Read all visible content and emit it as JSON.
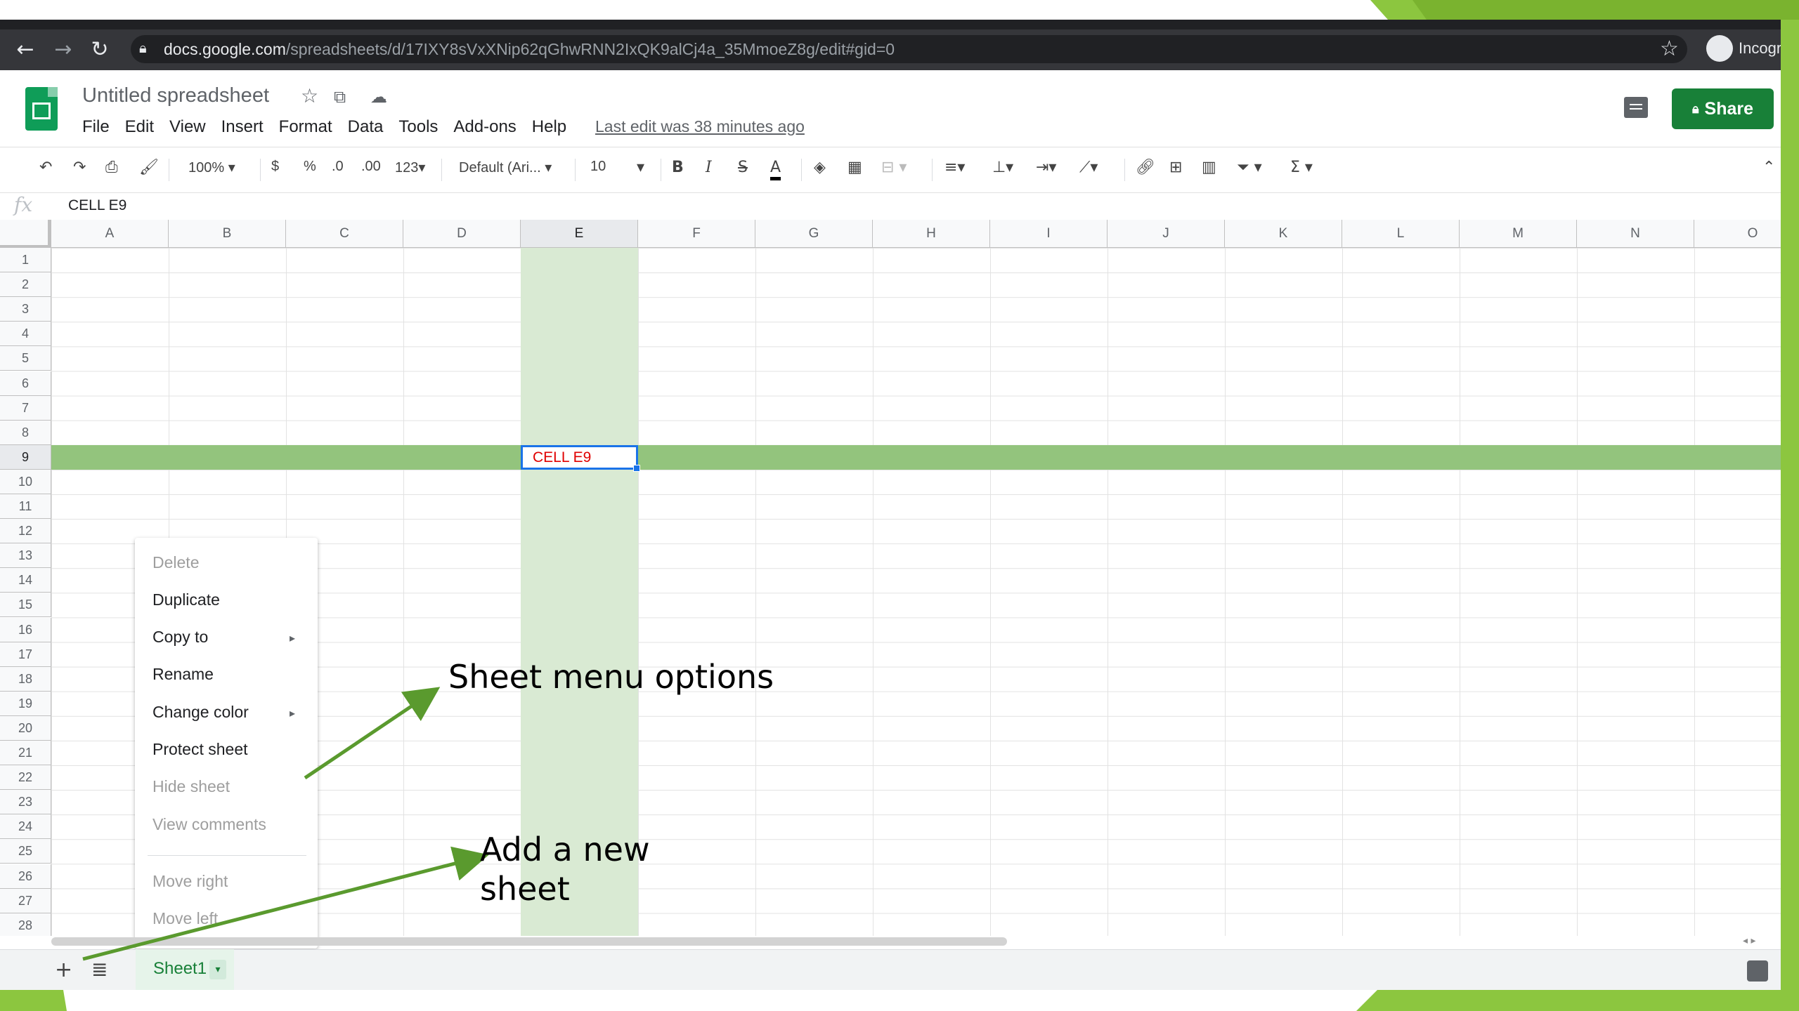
{
  "browser": {
    "url_host": "docs.google.com",
    "url_path": "/spreadsheets/d/17IXY8sVxXNip62qGhwRNN2IxQK9alCj4a_35MmoeZ8g/edit#gid=0",
    "profile_label": "Incogr"
  },
  "app": {
    "title": "Untitled spreadsheet",
    "menu": [
      "File",
      "Edit",
      "View",
      "Insert",
      "Format",
      "Data",
      "Tools",
      "Add-ons",
      "Help"
    ],
    "last_edit": "Last edit was 38 minutes ago",
    "share_label": "Share"
  },
  "toolbar": {
    "zoom": "100%",
    "currency": "$",
    "percent": "%",
    "dec_decrease": ".0",
    "dec_increase": ".00",
    "more_formats": "123",
    "font": "Default (Ari...",
    "font_size": "10",
    "bold": "B",
    "italic": "I",
    "strike": "S",
    "text_color": "A"
  },
  "formula_bar": {
    "fx": "fx",
    "value": "CELL E9"
  },
  "grid": {
    "columns": [
      "A",
      "B",
      "C",
      "D",
      "E",
      "F",
      "G",
      "H",
      "I",
      "J",
      "K",
      "L",
      "M",
      "N",
      "O"
    ],
    "rows": [
      "1",
      "2",
      "3",
      "4",
      "5",
      "6",
      "7",
      "8",
      "9",
      "10",
      "11",
      "12",
      "13",
      "14",
      "15",
      "16",
      "17",
      "18",
      "19",
      "20",
      "21",
      "22",
      "23",
      "24",
      "25",
      "26",
      "27",
      "28"
    ],
    "selected_column": "E",
    "selected_row": "9",
    "cell_e9": "CELL E9",
    "row_highlight_color": "#93c47d",
    "column_highlight_color": "#d9ead3"
  },
  "context_menu": {
    "items": [
      {
        "label": "Delete",
        "enabled": false
      },
      {
        "label": "Duplicate",
        "enabled": true
      },
      {
        "label": "Copy to",
        "enabled": true,
        "submenu": true
      },
      {
        "label": "Rename",
        "enabled": true
      },
      {
        "label": "Change color",
        "enabled": true,
        "submenu": true
      },
      {
        "label": "Protect sheet",
        "enabled": true
      },
      {
        "label": "Hide sheet",
        "enabled": false
      },
      {
        "label": "View comments",
        "enabled": false
      },
      {
        "label": "Move right",
        "enabled": false
      },
      {
        "label": "Move left",
        "enabled": false
      }
    ]
  },
  "sheet_tabs": {
    "add": "+",
    "active": "Sheet1"
  },
  "annotations": {
    "menu_options": "Sheet menu options",
    "add_sheet_line1": "Add a new",
    "add_sheet_line2": "sheet",
    "arrow_color": "#5a9a2e"
  },
  "theme": {
    "accent_green": "#188038",
    "slide_green": "#8cc63f"
  }
}
